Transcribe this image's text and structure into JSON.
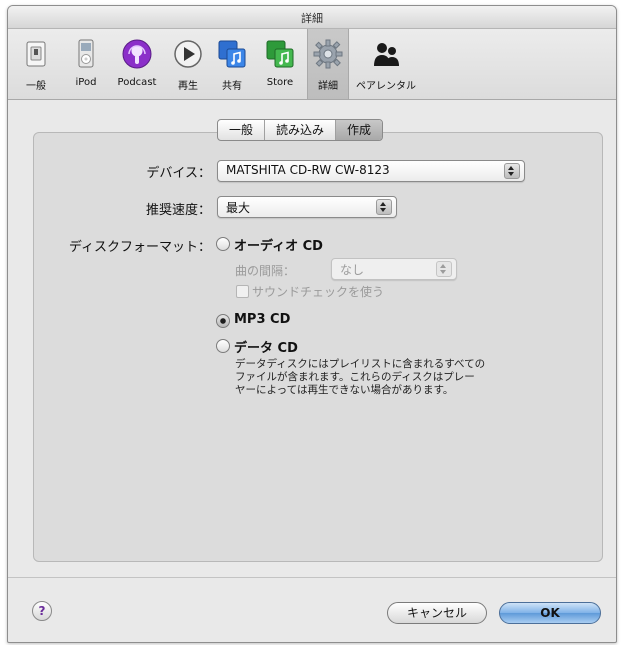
{
  "window": {
    "title": "詳細"
  },
  "toolbar": {
    "items": [
      {
        "label": "一般",
        "icon": "general-switch-icon"
      },
      {
        "label": "iPod",
        "icon": "ipod-icon"
      },
      {
        "label": "Podcast",
        "icon": "podcast-icon"
      },
      {
        "label": "再生",
        "icon": "play-icon"
      },
      {
        "label": "共有",
        "icon": "sharing-icon"
      },
      {
        "label": "Store",
        "icon": "store-icon"
      },
      {
        "label": "詳細",
        "icon": "gear-icon",
        "selected": true
      },
      {
        "label": "ペアレンタル",
        "icon": "parental-icon"
      }
    ]
  },
  "tabs": [
    {
      "label": "一般"
    },
    {
      "label": "読み込み"
    },
    {
      "label": "作成",
      "selected": true
    }
  ],
  "form": {
    "device_label": "デバイス：",
    "device_value": "MATSHITA CD-RW  CW-8123",
    "speed_label": "推奨速度：",
    "speed_value": "最大",
    "format_label": "ディスクフォーマット：",
    "audio_cd": "オーディオ CD",
    "gap_label": "曲の間隔：",
    "gap_value": "なし",
    "soundcheck_label": "サウンドチェックを使う",
    "mp3_cd": "MP3 CD",
    "data_cd": "データ CD",
    "data_desc_1": "データディスクにはプレイリストに含まれるすべての",
    "data_desc_2": "ファイルが含まれます。これらのディスクはプレー",
    "data_desc_3": "ヤーによっては再生できない場合があります。",
    "selected_format": "MP3 CD"
  },
  "buttons": {
    "help": "?",
    "cancel": "キャンセル",
    "ok": "OK"
  },
  "colors": {
    "accent": "#5f9ad9",
    "podcast": "#8b2fc9"
  }
}
